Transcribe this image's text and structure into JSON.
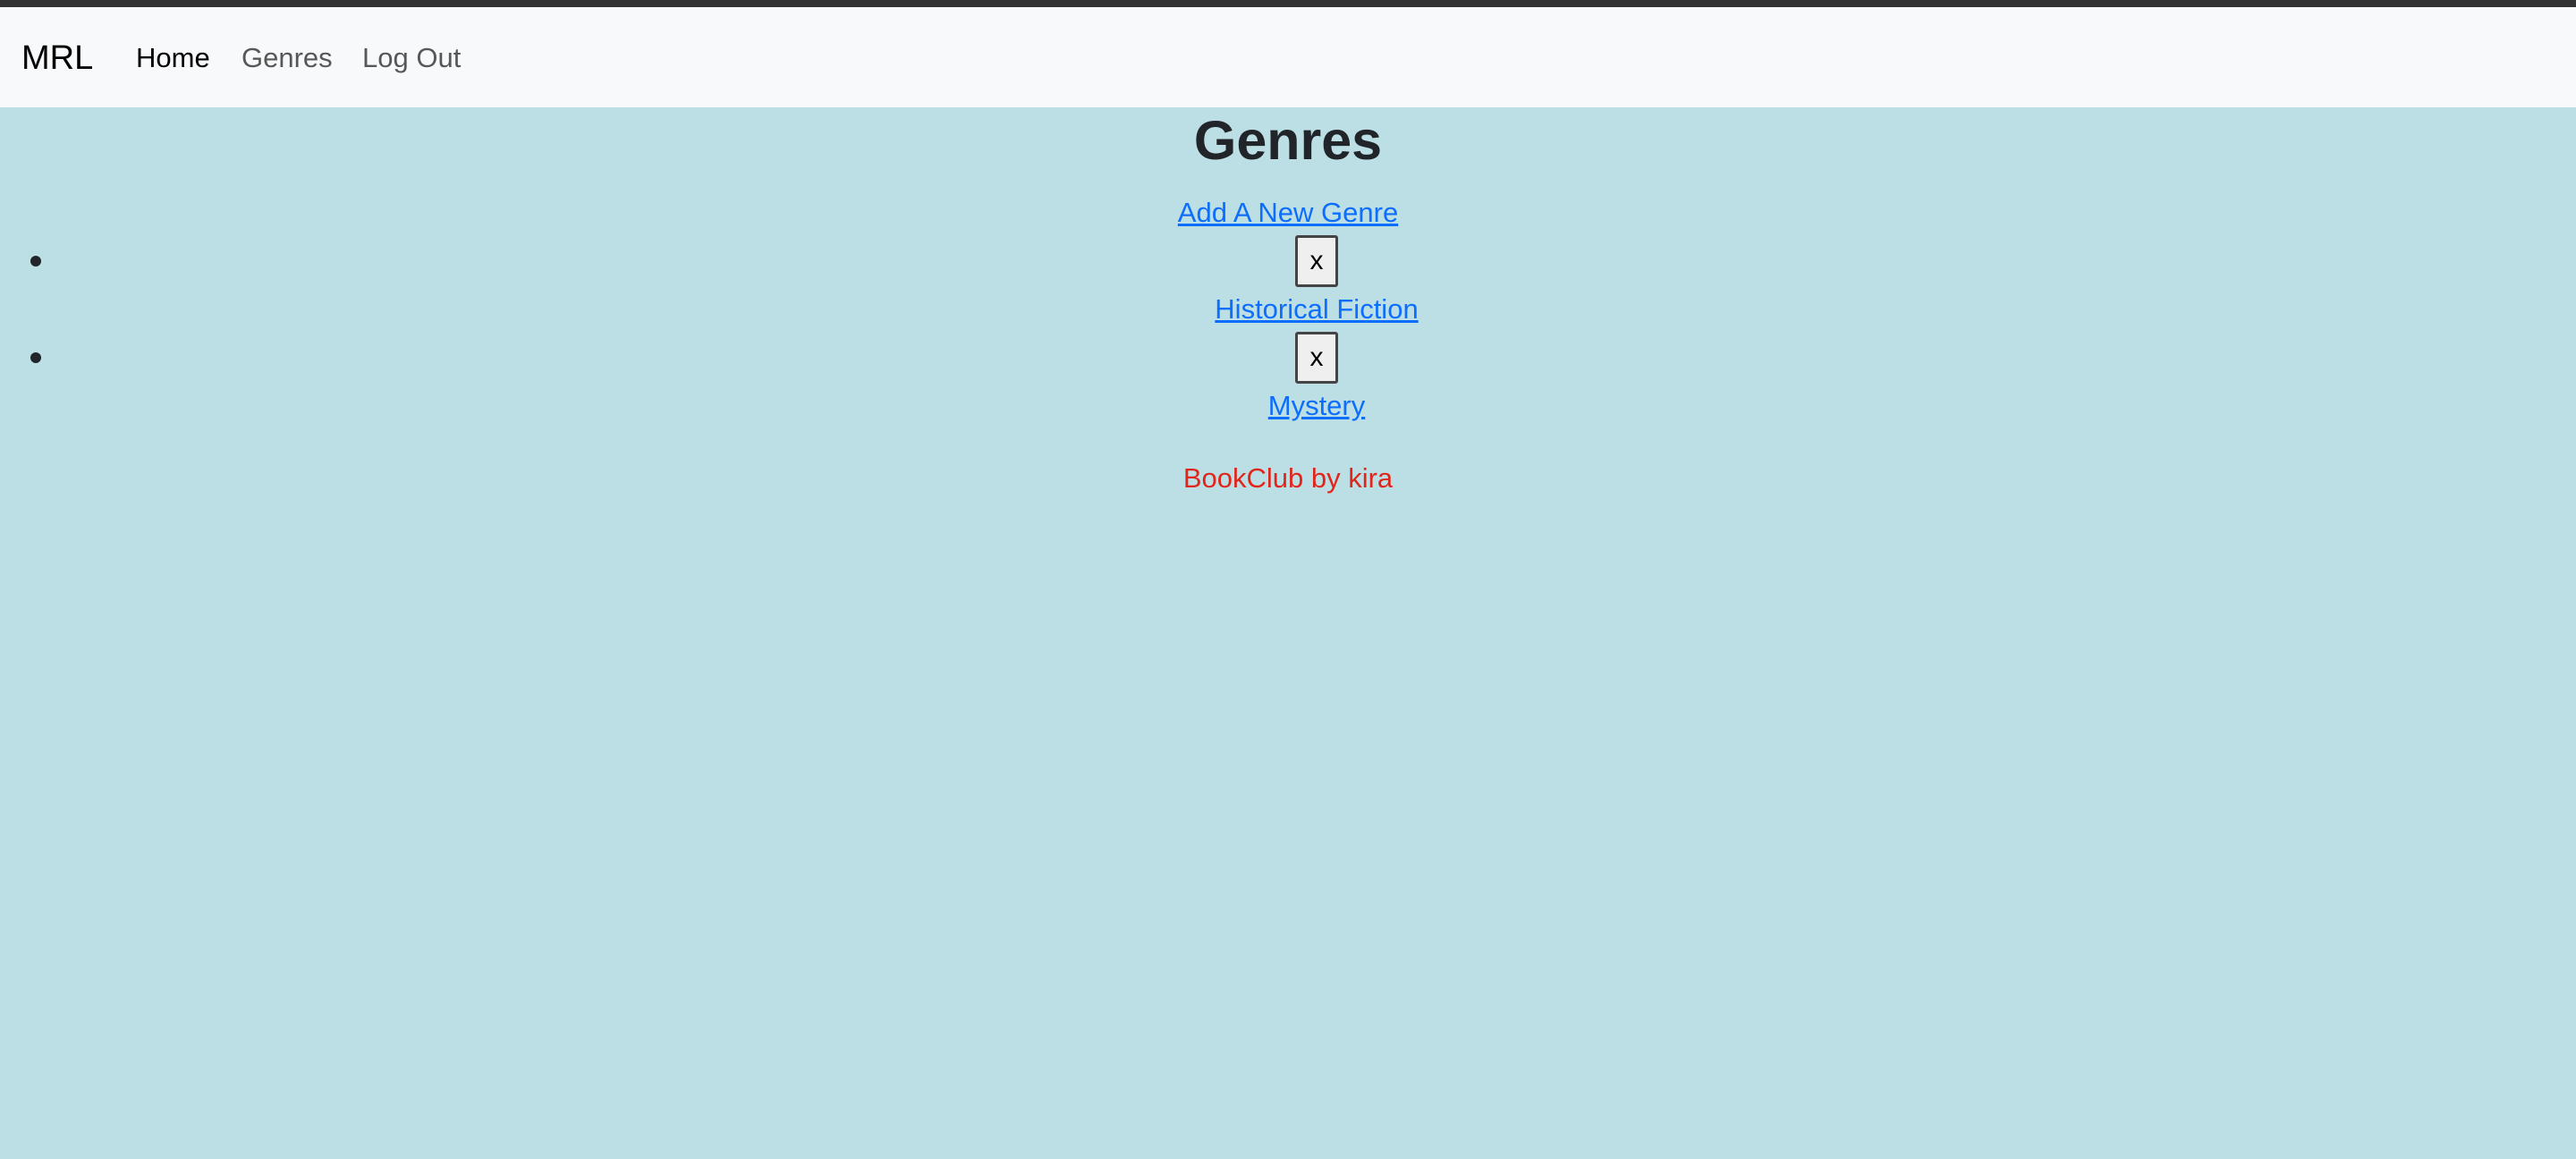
{
  "navbar": {
    "brand": "MRL",
    "links": [
      {
        "label": "Home",
        "active": true
      },
      {
        "label": "Genres",
        "active": false
      },
      {
        "label": "Log Out",
        "active": false
      }
    ]
  },
  "main": {
    "title": "Genres",
    "add_link": "Add A New Genre",
    "genres": [
      {
        "delete_label": "x",
        "name": "Historical Fiction"
      },
      {
        "delete_label": "x",
        "name": "Mystery"
      }
    ]
  },
  "footer": {
    "text": "BookClub by kira"
  },
  "colors": {
    "background": "#bbdfe5",
    "navbar": "#f8f9fa",
    "link": "#0d6efd",
    "footer_text": "#e0261b"
  }
}
